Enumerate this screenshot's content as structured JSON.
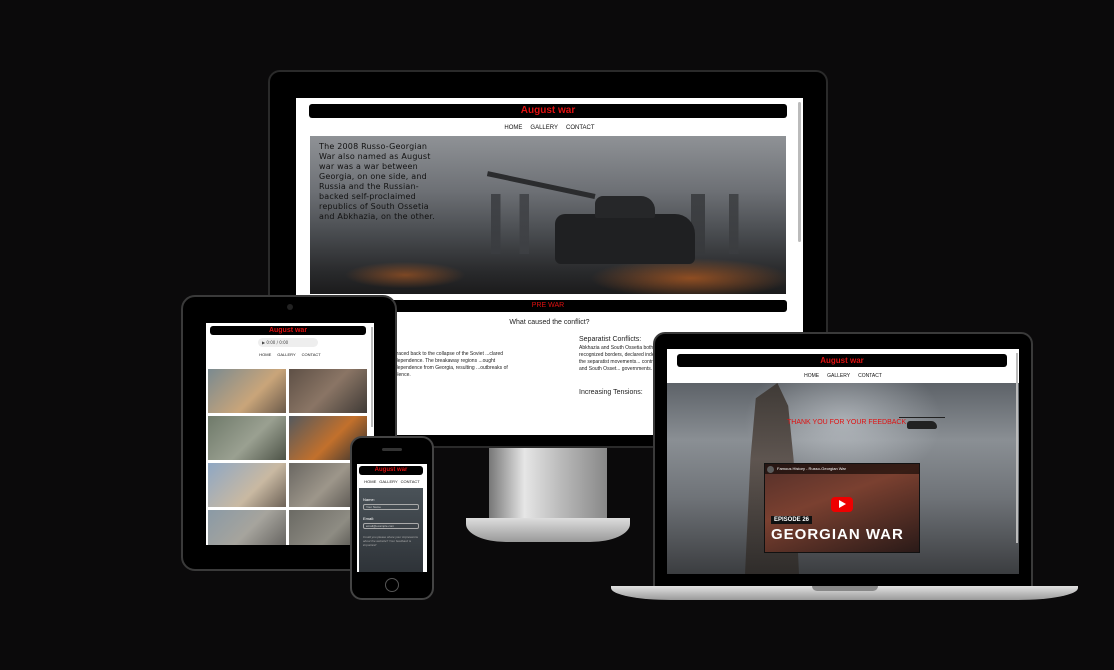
{
  "site": {
    "title": "August war",
    "nav": [
      "HOME",
      "GALLERY",
      "CONTACT"
    ]
  },
  "monitor": {
    "hero_text": "The 2008 Russo-Georgian War also named as August war was a war between Georgia, on one side, and Russia and the Russian-backed self-proclaimed republics of South Ossetia and Abkhazia, on the other.",
    "section_title": "PRE WAR",
    "question": "What caused the conflict?",
    "col1_text": "...traced back to the collapse of the Soviet ...clared independence. The breakaway regions ...ought independence from Georgia, resulting ...outbreaks of violence.",
    "col2_heading": "Separatist Conflicts:",
    "col2_text": "Abkhazia and South Ossetia both loc... recognized borders, declared indepe... supported the separatist movements... control of Abkhazia and South Osset... governments.",
    "col2_heading2": "Increasing Tensions:"
  },
  "tablet": {
    "audio_time": "0:00 / 0:00"
  },
  "phone": {
    "name_label": "Name:",
    "name_placeholder": "Your Name",
    "email_label": "Email:",
    "email_placeholder": "email@example.com",
    "message_placeholder": "Could you please share your impressions about the website? Your feedback is important!"
  },
  "laptop": {
    "feedback": "THANK YOU FOR YOUR FEEDBACK",
    "video_title": "Famous History - Russo-Georgian War",
    "video_episode": "EPISODE 26",
    "video_caption": "GEORGIAN WAR"
  },
  "colors": {
    "background": "#0b0a0b",
    "title_text": "#e01010",
    "title_bar": "#000000"
  }
}
